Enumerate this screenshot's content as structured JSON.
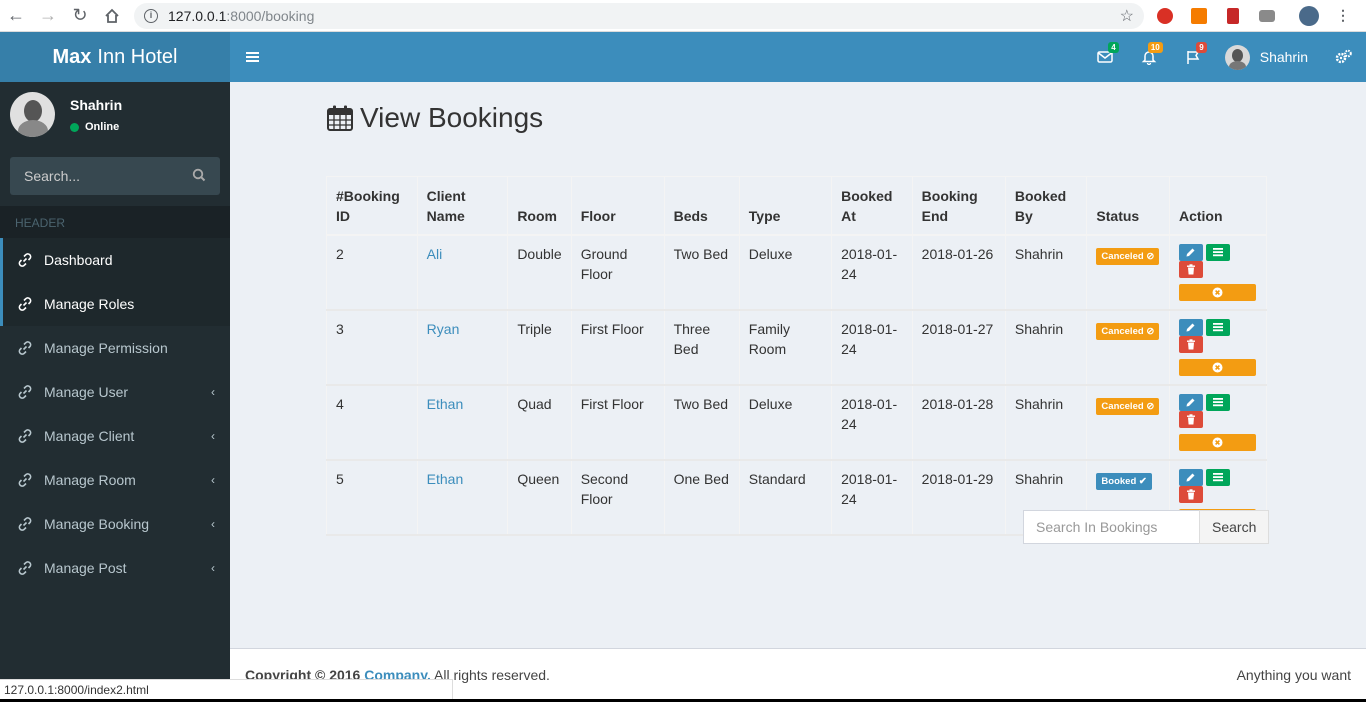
{
  "browser": {
    "url_host": "127.0.0.1",
    "url_path": ":8000/booking",
    "status_url": "127.0.0.1:8000/index2.html"
  },
  "app": {
    "logo_bold": "Max",
    "logo_rest": "Inn Hotel"
  },
  "topnav": {
    "mail_count": "4",
    "notif_count": "10",
    "flag_count": "9",
    "user_name": "Shahrin",
    "colors": {
      "mail_badge": "#00a65a",
      "notif_badge": "#f39c12",
      "flag_badge": "#dd4b39"
    }
  },
  "sidebar": {
    "user_name": "Shahrin",
    "user_status": "Online",
    "search_placeholder": "Search...",
    "header": "HEADER",
    "items": [
      {
        "label": "Dashboard",
        "active": true,
        "has_children": false
      },
      {
        "label": "Manage Roles",
        "active": true,
        "has_children": false
      },
      {
        "label": "Manage Permission",
        "active": false,
        "has_children": false
      },
      {
        "label": "Manage User",
        "active": false,
        "has_children": true
      },
      {
        "label": "Manage Client",
        "active": false,
        "has_children": true
      },
      {
        "label": "Manage Room",
        "active": false,
        "has_children": true
      },
      {
        "label": "Manage Booking",
        "active": false,
        "has_children": true
      },
      {
        "label": "Manage Post",
        "active": false,
        "has_children": true
      }
    ]
  },
  "main": {
    "title": "View Bookings",
    "table": {
      "columns": [
        "#Booking ID",
        "Client Name",
        "Room",
        "Floor",
        "Beds",
        "Type",
        "Booked At",
        "Booking End",
        "Booked By",
        "Status",
        "Action"
      ],
      "rows": [
        {
          "id": "2",
          "client": "Ali",
          "room": "Double",
          "floor": "Ground Floor",
          "beds": "Two Bed",
          "type": "Deluxe",
          "booked_at": "2018-01-24",
          "booking_end": "2018-01-26",
          "booked_by": "Shahrin",
          "status": "Canceled"
        },
        {
          "id": "3",
          "client": "Ryan",
          "room": "Triple",
          "floor": "First Floor",
          "beds": "Three Bed",
          "type": "Family Room",
          "booked_at": "2018-01-24",
          "booking_end": "2018-01-27",
          "booked_by": "Shahrin",
          "status": "Canceled"
        },
        {
          "id": "4",
          "client": "Ethan",
          "room": "Quad",
          "floor": "First Floor",
          "beds": "Two Bed",
          "type": "Deluxe",
          "booked_at": "2018-01-24",
          "booking_end": "2018-01-28",
          "booked_by": "Shahrin",
          "status": "Canceled"
        },
        {
          "id": "5",
          "client": "Ethan",
          "room": "Queen",
          "floor": "Second Floor",
          "beds": "One Bed",
          "type": "Standard",
          "booked_at": "2018-01-24",
          "booking_end": "2018-01-29",
          "booked_by": "Shahrin",
          "status": "Booked"
        }
      ]
    },
    "search": {
      "placeholder": "Search In Bookings",
      "button_label": "Search"
    }
  },
  "footer": {
    "copyright_prefix": "Copyright © 2016",
    "company": "Company.",
    "rights": "All rights reserved.",
    "right_text": "Anything you want"
  }
}
